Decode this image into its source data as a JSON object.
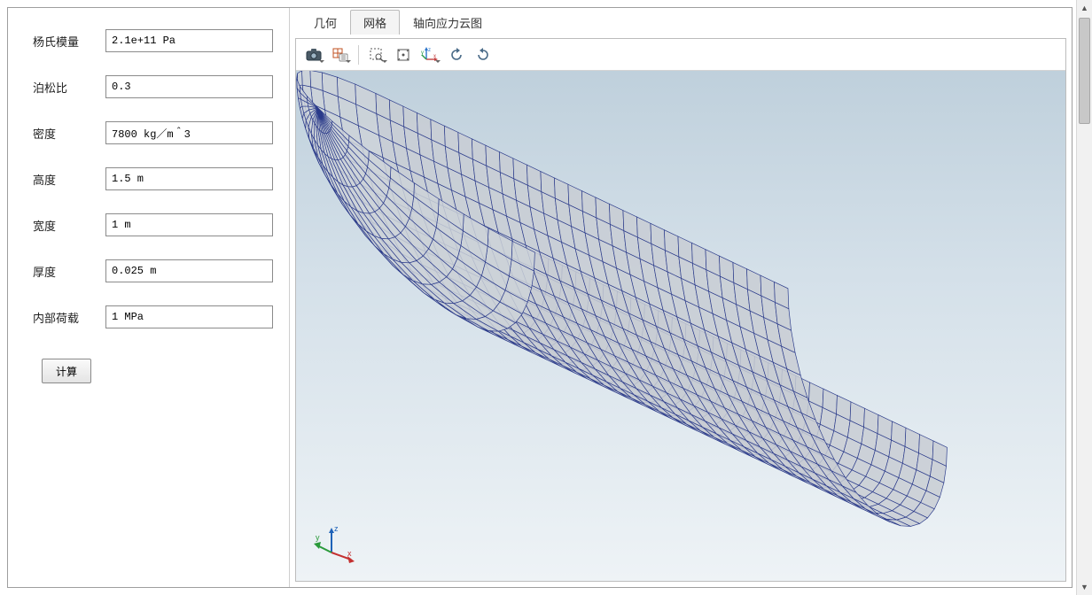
{
  "form": {
    "fields": [
      {
        "label": "杨氏模量",
        "value": "2.1e+11 Pa"
      },
      {
        "label": "泊松比",
        "value": "0.3"
      },
      {
        "label": "密度",
        "value": "7800 kg／m＾3"
      },
      {
        "label": "高度",
        "value": "1.5 m"
      },
      {
        "label": "宽度",
        "value": "1 m"
      },
      {
        "label": "厚度",
        "value": "0.025 m"
      },
      {
        "label": "内部荷载",
        "value": "1 MPa"
      }
    ],
    "compute_label": "计算"
  },
  "tabs": [
    {
      "label": "几何",
      "active": false
    },
    {
      "label": "网格",
      "active": true
    },
    {
      "label": "轴向应力云图",
      "active": false
    }
  ],
  "toolbar": {
    "icons": [
      "camera-icon",
      "grid-settings-icon",
      "zoom-box-icon",
      "zoom-extents-icon",
      "axes-icon",
      "rotate-ccw-icon",
      "rotate-cw-icon"
    ]
  },
  "triad": {
    "x": "x",
    "y": "y",
    "z": "z"
  }
}
